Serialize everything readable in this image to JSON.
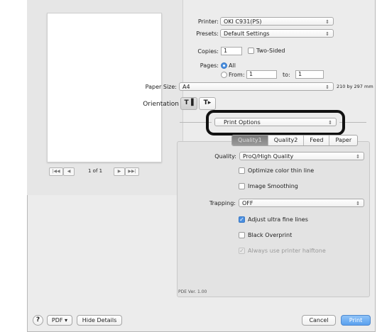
{
  "preview": {
    "nav_first": "|◀◀",
    "nav_prev": "◀",
    "page_indicator": "1 of 1",
    "nav_next": "▶",
    "nav_last": "▶▶|"
  },
  "printer": {
    "label": "Printer:",
    "value": "OKI C931(PS)"
  },
  "presets": {
    "label": "Presets:",
    "value": "Default Settings"
  },
  "copies": {
    "label": "Copies:",
    "value": "1",
    "two_sided_label": "Two-Sided",
    "two_sided_checked": false
  },
  "pages": {
    "label": "Pages:",
    "all_label": "All",
    "from_label": "From:",
    "from_value": "1",
    "to_label": "to:",
    "to_value": "1"
  },
  "paper_size": {
    "label": "Paper Size:",
    "value": "A4",
    "dimensions": "210 by 297 mm"
  },
  "orientation": {
    "label": "Orientation",
    "portrait_icon": "portrait-orientation-icon",
    "landscape_icon": "landscape-orientation-icon"
  },
  "panel_popup": {
    "value": "Print Options"
  },
  "tabs": [
    {
      "label": "Quality1",
      "selected": true
    },
    {
      "label": "Quality2",
      "selected": false
    },
    {
      "label": "Feed",
      "selected": false
    },
    {
      "label": "Paper",
      "selected": false
    }
  ],
  "quality": {
    "label": "Quality:",
    "value": "ProQ/High Quality"
  },
  "optimize_color": {
    "label": "Optimize color thin line",
    "checked": false
  },
  "image_smoothing": {
    "label": "Image Smoothing",
    "checked": false
  },
  "trapping": {
    "label": "Trapping:",
    "value": "OFF"
  },
  "adjust_fine_lines": {
    "label": "Adjust ultra fine lines",
    "checked": true
  },
  "black_overprint": {
    "label": "Black Overprint",
    "checked": false
  },
  "printer_halftone": {
    "label": "Always use printer halftone",
    "checked": true,
    "disabled": true
  },
  "pde_version": "PDE Ver. 1.00",
  "footer": {
    "help": "?",
    "pdf_label": "PDF ▾",
    "hide_details": "Hide Details",
    "cancel": "Cancel",
    "print": "Print"
  },
  "colors": {
    "accent": "#4a8fe0",
    "highlight_border": "#111111"
  }
}
